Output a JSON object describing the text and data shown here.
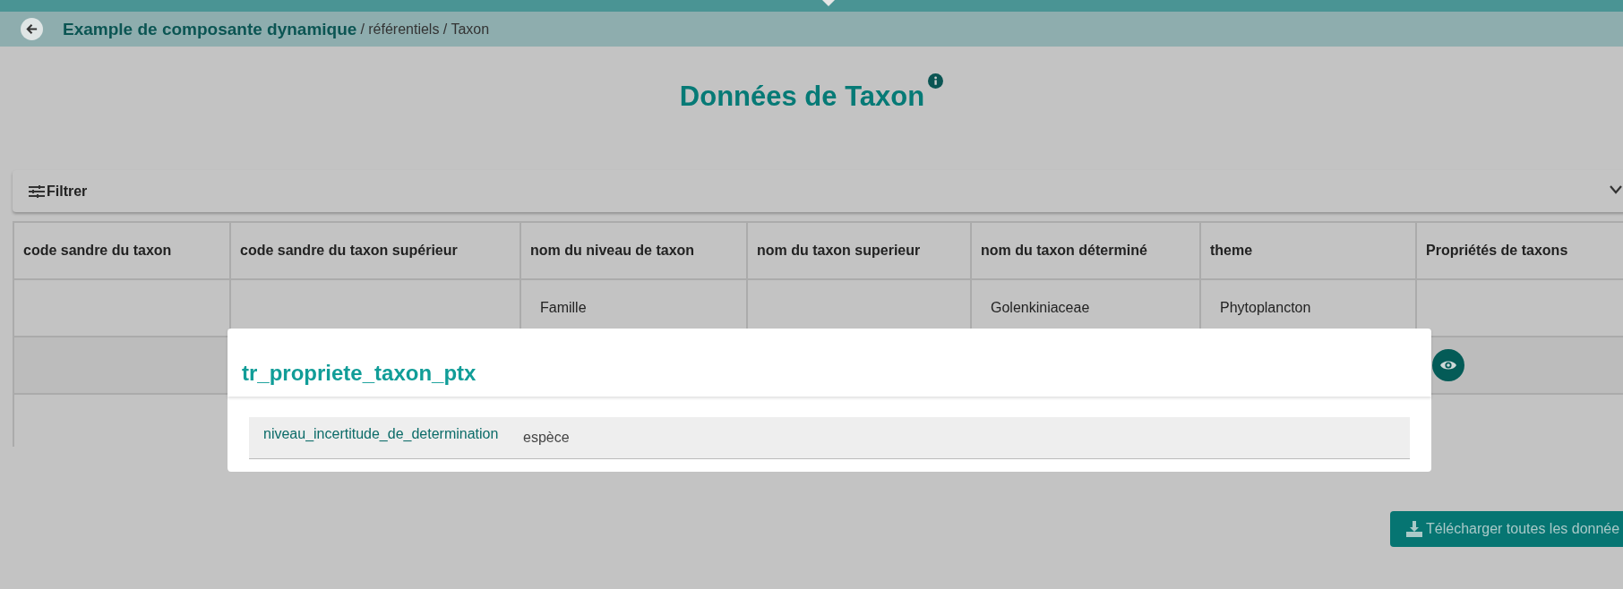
{
  "header": {
    "title": "Example de composante dynamique",
    "breadcrumb": "/ référentiels / Taxon"
  },
  "page_title": "Données de Taxon",
  "filter": {
    "label": "Filtrer"
  },
  "table": {
    "columns": [
      "code sandre du taxon",
      "code sandre du taxon supérieur",
      "nom du niveau de taxon",
      "nom du taxon superieur",
      "nom du taxon déterminé",
      "theme",
      "Propriétés de taxons"
    ],
    "rows": [
      {
        "cells": [
          null,
          null,
          "Famille",
          null,
          "Golenkiniaceae",
          "Phytoplancton",
          null
        ],
        "view_button": false
      },
      {
        "cells": [
          null,
          null,
          null,
          null,
          null,
          null,
          null
        ],
        "view_button": true
      },
      {
        "cells": [
          null,
          null,
          null,
          null,
          null,
          null,
          null
        ],
        "view_button": false
      }
    ]
  },
  "dialog": {
    "title": "tr_propriete_taxon_ptx",
    "properties": [
      {
        "name": "niveau_incertitude_de_determination",
        "value": "espèce"
      }
    ]
  },
  "download_button": "Télécharger toutes les donnée"
}
